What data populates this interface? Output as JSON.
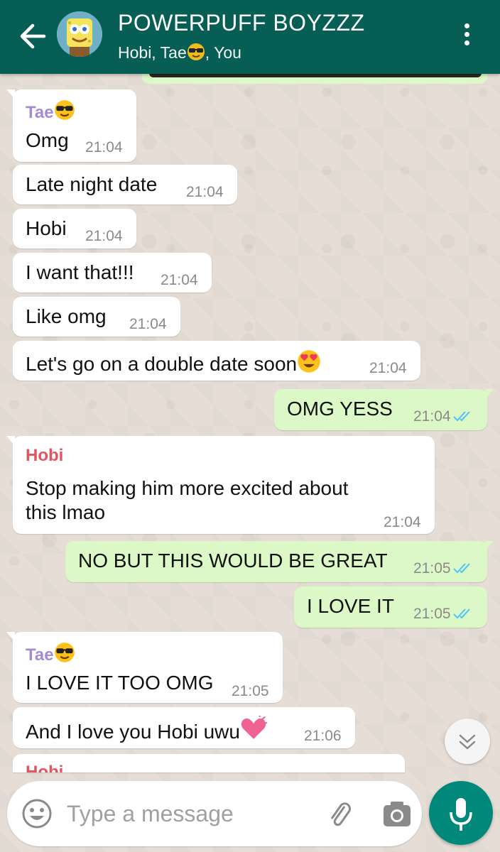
{
  "header": {
    "title": "POWERPUFF BOYZZZ",
    "subtitle_a": "Hobi, Tae",
    "subtitle_b": ", You",
    "color": "#075e54"
  },
  "messages": [
    {
      "sender": "Tae",
      "sender_color": "#a58bd6",
      "text": "Omg",
      "time": "21:04",
      "dir": "in"
    },
    {
      "text": "Late night date",
      "time": "21:04",
      "dir": "in"
    },
    {
      "text": "Hobi",
      "time": "21:04",
      "dir": "in"
    },
    {
      "text": "I want that!!!",
      "time": "21:04",
      "dir": "in"
    },
    {
      "text": "Like omg",
      "time": "21:04",
      "dir": "in"
    },
    {
      "text": "Let's go on a double date soon",
      "time": "21:04",
      "dir": "in",
      "emoji": "heart-eyes-emoji"
    },
    {
      "text": "OMG YESS",
      "time": "21:04",
      "dir": "out",
      "status": "read"
    },
    {
      "sender": "Hobi",
      "sender_color": "#e5535e",
      "text_line1": "Stop making him more excited about",
      "text_line2": "this lmao",
      "time": "21:04",
      "dir": "in"
    },
    {
      "text": "NO BUT THIS WOULD BE GREAT",
      "time": "21:05",
      "dir": "out",
      "status": "read"
    },
    {
      "text": "I LOVE IT",
      "time": "21:05",
      "dir": "out",
      "status": "read"
    },
    {
      "sender": "Tae",
      "sender_color": "#a58bd6",
      "text": "I LOVE IT TOO OMG",
      "time": "21:05",
      "dir": "in"
    },
    {
      "text": "And I love you Hobi uwu",
      "time": "21:06",
      "dir": "in",
      "emoji": "pink-heart-emoji"
    },
    {
      "sender": "Hobi",
      "sender_color": "#e5535e",
      "dir": "in",
      "partial": true
    }
  ],
  "input": {
    "placeholder": "Type a message"
  },
  "colors": {
    "incoming": "#ffffff",
    "outgoing": "#dcf8c6",
    "read_ticks": "#4fc3f7",
    "mic": "#00897b"
  }
}
